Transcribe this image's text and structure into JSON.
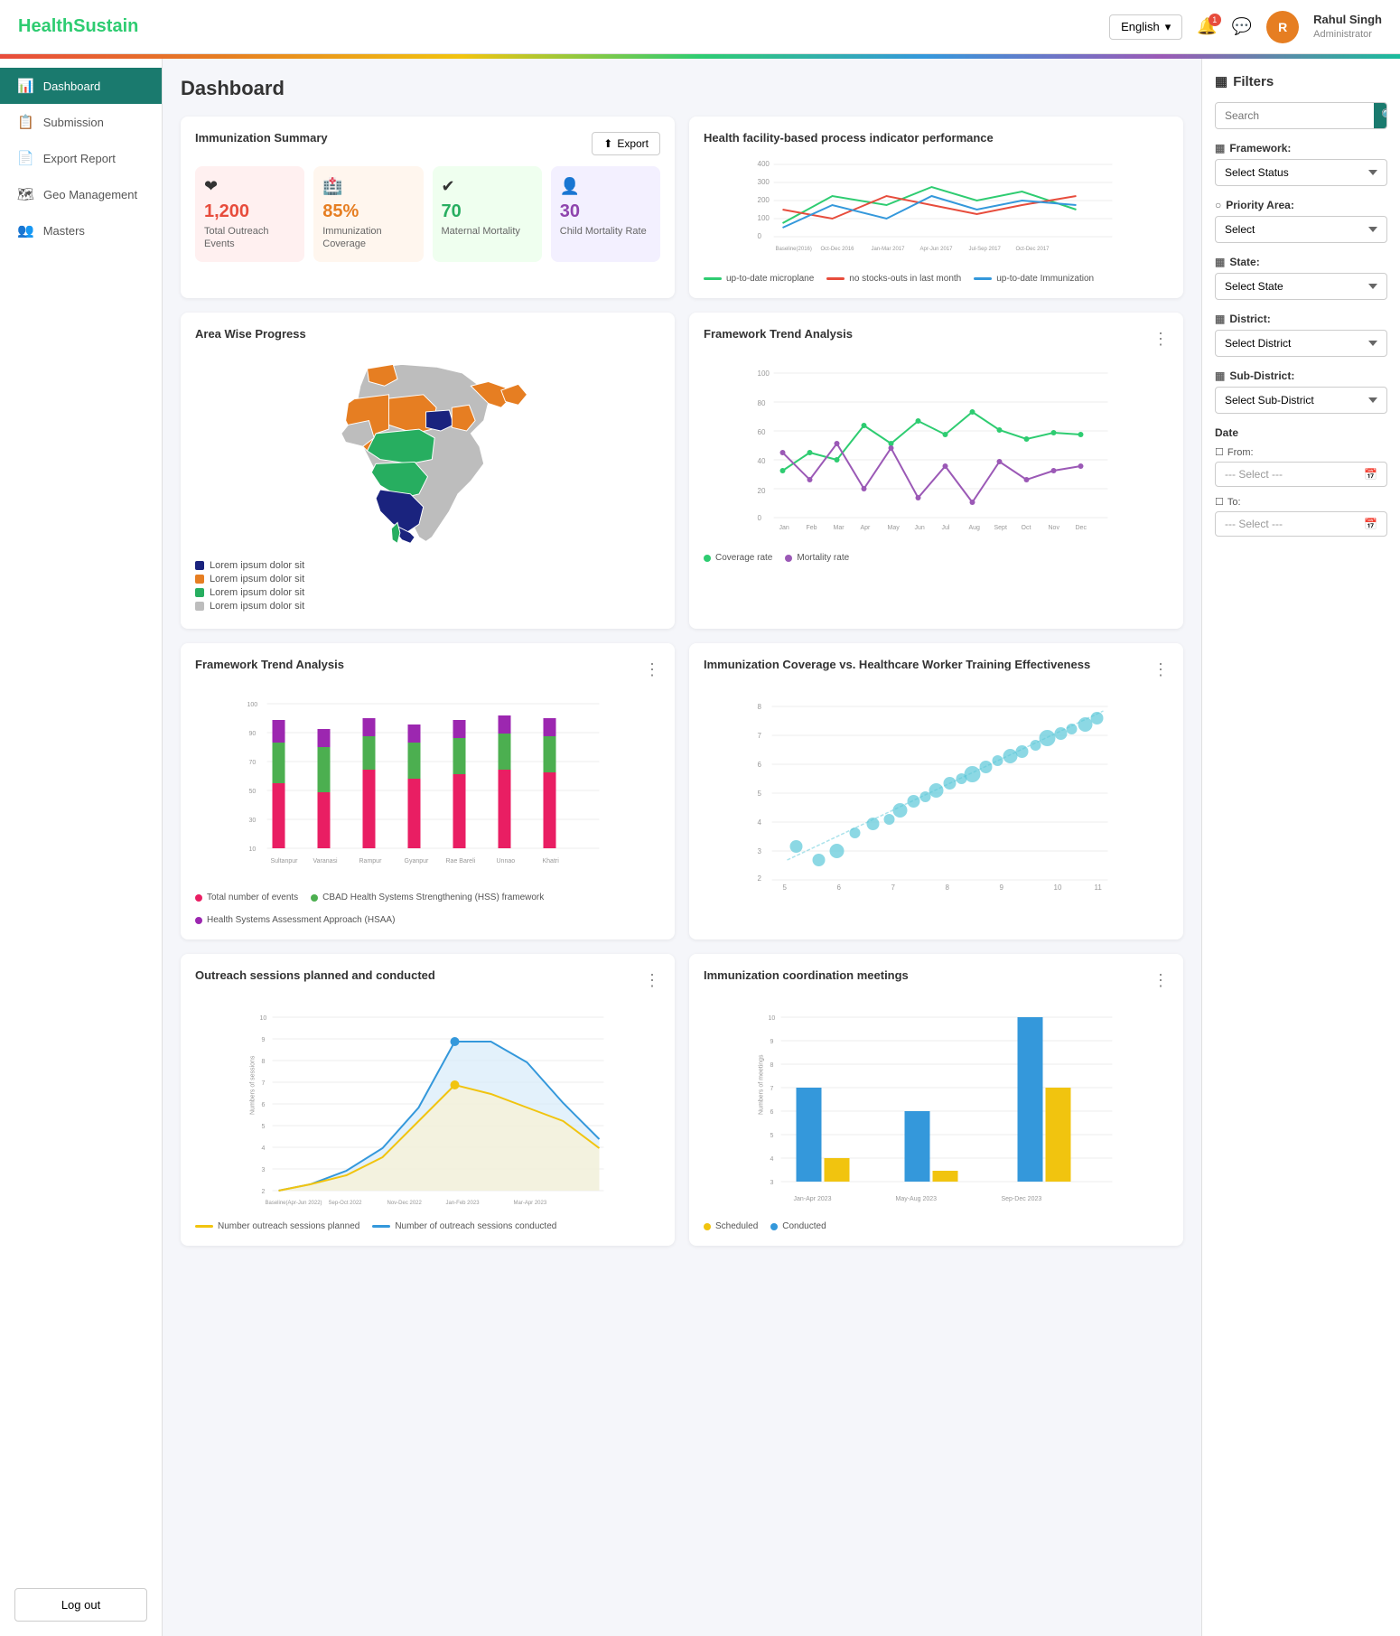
{
  "header": {
    "logo": "HealthSustain",
    "lang_label": "English",
    "notif_count": "1",
    "user_initial": "R",
    "user_name": "Rahul Singh",
    "user_role": "Administrator"
  },
  "sidebar": {
    "items": [
      {
        "id": "dashboard",
        "label": "Dashboard",
        "icon": "📊",
        "active": true
      },
      {
        "id": "submission",
        "label": "Submission",
        "icon": "📋"
      },
      {
        "id": "export",
        "label": "Export Report",
        "icon": "📄"
      },
      {
        "id": "geo",
        "label": "Geo Management",
        "icon": "🗺"
      },
      {
        "id": "masters",
        "label": "Masters",
        "icon": "👥"
      }
    ],
    "logout_label": "Log out"
  },
  "page_title": "Dashboard",
  "immunization": {
    "card_title": "Immunization Summary",
    "export_label": "Export",
    "stats": [
      {
        "id": "outreach",
        "value": "1,200",
        "label": "Total Outreach Events",
        "color": "pink",
        "icon": "❤"
      },
      {
        "id": "coverage",
        "value": "85%",
        "label": "Immunization Coverage",
        "color": "orange",
        "icon": "🏥"
      },
      {
        "id": "maternal",
        "value": "70",
        "label": "Maternal Mortality",
        "color": "green",
        "icon": "✔"
      },
      {
        "id": "child",
        "value": "30",
        "label": "Child Mortality Rate",
        "color": "purple",
        "icon": "👤"
      }
    ]
  },
  "health_facility": {
    "title": "Health facility-based process indicator performance",
    "legend": [
      {
        "label": "up-to-date microplane",
        "color": "#2ecc71"
      },
      {
        "label": "no stocks-outs in last month",
        "color": "#e74c3c"
      },
      {
        "label": "up-to-date Immunization",
        "color": "#3498db"
      }
    ]
  },
  "area_wise": {
    "title": "Area Wise Progress",
    "legend": [
      {
        "label": "Lorem ipsum dolor sit",
        "color": "#1a237e"
      },
      {
        "label": "Lorem ipsum dolor sit",
        "color": "#e67e22"
      },
      {
        "label": "Lorem ipsum dolor sit",
        "color": "#27ae60"
      },
      {
        "label": "Lorem ipsum dolor sit",
        "color": "#bdbdbd"
      }
    ]
  },
  "framework_trend": {
    "title": "Framework Trend Analysis",
    "legend": [
      {
        "label": "Coverage rate",
        "color": "#2ecc71"
      },
      {
        "label": "Mortality rate",
        "color": "#9b59b6"
      }
    ]
  },
  "framework_trend2": {
    "title": "Framework Trend Analysis",
    "legend": [
      {
        "label": "Total number of events",
        "color": "#e91e63"
      },
      {
        "label": "CBAD Health Systems Strengthening (HSS) framework",
        "color": "#4caf50"
      },
      {
        "label": "Health Systems Assessment Approach (HSAA)",
        "color": "#9c27b0"
      }
    ]
  },
  "immunization_coverage": {
    "title": "Immunization Coverage vs. Healthcare Worker Training Effectiveness"
  },
  "outreach": {
    "title": "Outreach sessions planned and conducted",
    "legend": [
      {
        "label": "Number outreach sessions planned",
        "color": "#f1c40f"
      },
      {
        "label": "Number of outreach sessions conducted",
        "color": "#3498db"
      }
    ]
  },
  "coordination": {
    "title": "Immunization coordination meetings",
    "legend": [
      {
        "label": "Scheduled",
        "color": "#f1c40f"
      },
      {
        "label": "Conducted",
        "color": "#3498db"
      }
    ]
  },
  "filters": {
    "title": "Filters",
    "search_placeholder": "Search",
    "framework_label": "Framework:",
    "framework_placeholder": "Select Status",
    "priority_label": "Priority Area:",
    "priority_placeholder": "Select",
    "state_label": "State:",
    "state_placeholder": "Select State",
    "district_label": "District:",
    "district_placeholder": "Select District",
    "subdistrict_label": "Sub-District:",
    "subdistrict_placeholder": "Select Sub-District",
    "date_label": "Date",
    "from_label": "From:",
    "from_placeholder": "--- Select ---",
    "to_label": "To:",
    "to_placeholder": "--- Select ---",
    "select_label_1": "Select",
    "select_label_2": "Select State",
    "select_label_3": "Select -",
    "select_label_4": "Select"
  }
}
